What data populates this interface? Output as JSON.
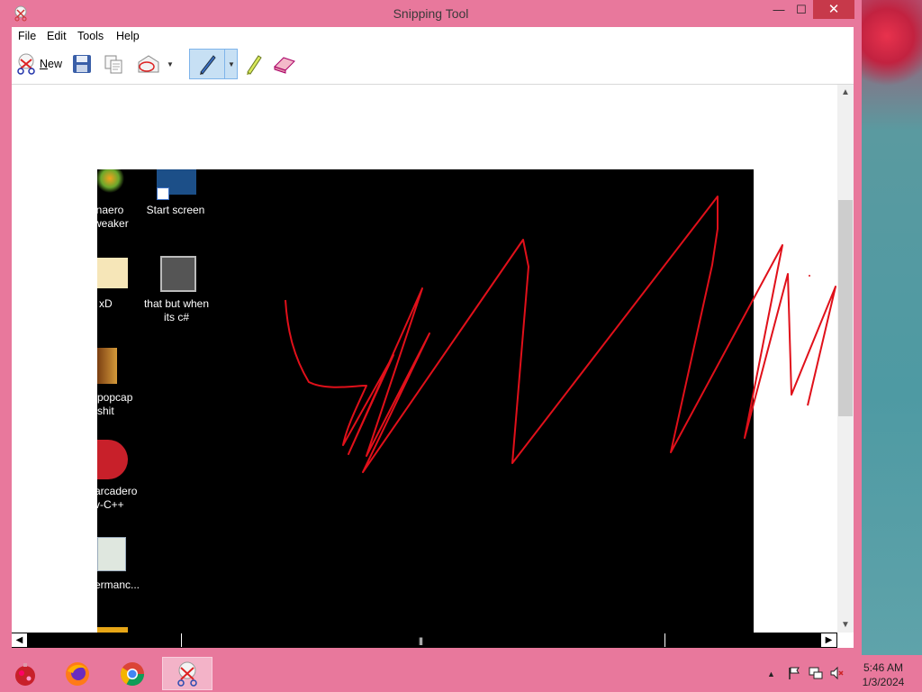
{
  "window": {
    "title": "Snipping Tool",
    "controls": {
      "minimize": "—",
      "maximize": "☐",
      "close": "✕"
    }
  },
  "menu": [
    "File",
    "Edit",
    "Tools",
    "Help"
  ],
  "toolbar": {
    "new_label": "New",
    "new_underline": "N",
    "new_rest": "ew",
    "icons": [
      "new-snip-icon",
      "save-icon",
      "copy-icon",
      "send-snip-icon",
      "pen-icon",
      "highlighter-icon",
      "eraser-icon"
    ]
  },
  "snip": {
    "desktop_icons": [
      {
        "label": "inaero\nweaker"
      },
      {
        "label": "Start screen"
      },
      {
        "label": "xD"
      },
      {
        "label": "that but when\nits c#"
      },
      {
        "label": "popcap\nshit"
      },
      {
        "label": "arcadero\nv-C++"
      },
      {
        "label": "ermanc..."
      }
    ],
    "ink_color": "#e0101a"
  },
  "taskbar": {
    "apps": [
      "app-menu-icon",
      "firefox-icon",
      "chrome-icon",
      "snipping-tool-icon"
    ],
    "clock_time": "5:46 AM",
    "clock_date": "1/3/2024"
  },
  "colors": {
    "frame": "#e8789c",
    "close_button": "#c7394a",
    "pen_selected": "#c7e0f4"
  }
}
